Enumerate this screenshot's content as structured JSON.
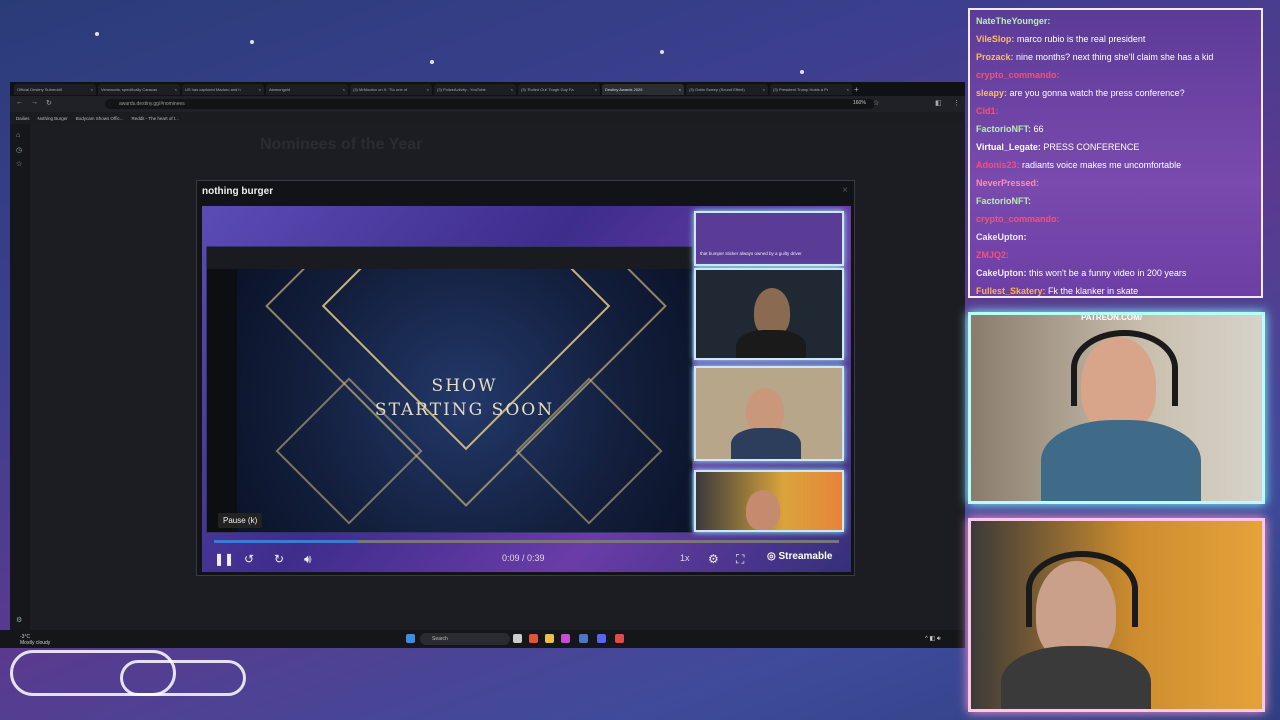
{
  "browser": {
    "tabs": [
      {
        "label": "Official Destiny Subreddit"
      },
      {
        "label": "Venezuela, specifically Caracas"
      },
      {
        "label": "US has captured Maduro and h"
      },
      {
        "label": "Aiamongold"
      },
      {
        "label": "(3) MrMouton on X: \"So one of"
      },
      {
        "label": "(3) PoliceActivity - YouTube"
      },
      {
        "label": "(3) 'Rolled Out' Tough Guy Fa"
      },
      {
        "label": "Destiny Awards 2025"
      },
      {
        "label": "(3) Gotta Sweep (Sound Effect)"
      },
      {
        "label": "(3) President Trump Holds a Pr"
      }
    ],
    "url": "awards.destiny.gg/#nominees",
    "zoom": "160%",
    "bookmarks": [
      "Dailies",
      "Nothing Burger",
      "Bodycam Shows Offic...",
      "Reddit - The heart of t..."
    ]
  },
  "page": {
    "title": "Nominees of the Year"
  },
  "modal": {
    "title": "nothing burger",
    "show_text_line1": "SHOW",
    "show_text_line2": "STARTING SOON",
    "tooltip": "Pause (k)",
    "time": "0:09 / 0:39",
    "progress": 0.23,
    "speed": "1x",
    "brand": "Streamable",
    "inner_chat_caption": "that bumper sticker always owned by a guilty driver"
  },
  "taskbar": {
    "weather_temp": "-3°C",
    "weather_desc": "Mostly cloudy",
    "search_placeholder": "Search"
  },
  "chat": {
    "messages": [
      {
        "user": "NateTheYounger:",
        "text": "",
        "color": "#b6f0a8"
      },
      {
        "user": "VileSlop:",
        "text": "marco rubio is the real president",
        "color": "#f9c05a"
      },
      {
        "user": "Prozack:",
        "text": "nine months? next thing she'll claim she has a kid",
        "color": "#f9c05a"
      },
      {
        "user": "crypto_commando:",
        "text": "",
        "color": "#ff4d6d"
      },
      {
        "user": "sleapy:",
        "text": "are you gonna watch the press conference?",
        "color": "#f9c05a"
      },
      {
        "user": "Cid1:",
        "text": "",
        "color": "#ff4d6d"
      },
      {
        "user": "FactorioNFT:",
        "text": "66",
        "color": "#b6f0a8"
      },
      {
        "user": "Virtual_Legate:",
        "text": "PRESS CONFERENCE",
        "color": "#ffffff"
      },
      {
        "user": "Adonis23:",
        "text": "radiants voice makes me uncomfortable",
        "color": "#ff4d6d"
      },
      {
        "user": "NeverPressed:",
        "text": "",
        "color": "#ff8fb0"
      },
      {
        "user": "FactorioNFT:",
        "text": "",
        "color": "#b6f0a8"
      },
      {
        "user": "crypto_commando:",
        "text": "",
        "color": "#ff4d6d"
      },
      {
        "user": "CakeUpton:",
        "text": "",
        "color": "#f3e8ff"
      },
      {
        "user": "ZMJQ2:",
        "text": "",
        "color": "#ff4d6d"
      },
      {
        "user": "CakeUpton:",
        "text": "this won't be a funny video in 200 years",
        "color": "#f3e8ff"
      },
      {
        "user": "Fullest_Skatery:",
        "text": "Fk the klanker in skate",
        "color": "#ffb347"
      }
    ]
  },
  "overlay": {
    "patreon": "PATREON.COM/"
  }
}
